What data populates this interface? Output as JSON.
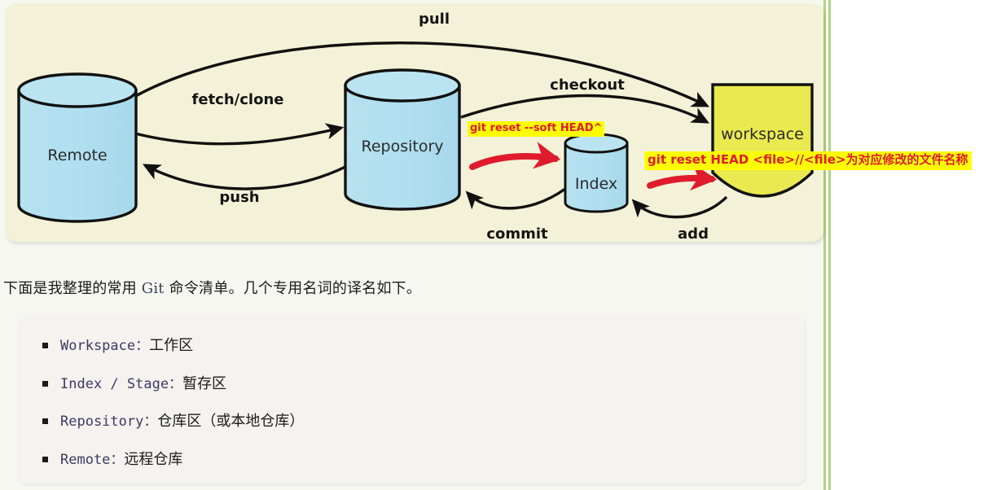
{
  "page": {
    "background_color": "#f7f7f2",
    "gutter_color": "#aed581"
  },
  "diagram": {
    "panel_color": "#f3f2d8",
    "cylinder_color": "#ade0ee",
    "workspace_color": "#eae94f",
    "arrow_color": "#111111",
    "annotation_highlight": "#ffff00",
    "annotation_text_color": "#e01b2e",
    "nodes": [
      {
        "id": "remote",
        "label": "Remote",
        "shape": "cylinder"
      },
      {
        "id": "repository",
        "label": "Repository",
        "shape": "cylinder"
      },
      {
        "id": "index",
        "label": "Index",
        "shape": "cylinder"
      },
      {
        "id": "workspace",
        "label": "workspace",
        "shape": "rounded-box"
      }
    ],
    "edges": [
      {
        "id": "pull",
        "label": "pull",
        "from": "remote",
        "to": "workspace"
      },
      {
        "id": "fetch-clone",
        "label": "fetch/clone",
        "from": "remote",
        "to": "repository"
      },
      {
        "id": "push",
        "label": "push",
        "from": "repository",
        "to": "remote"
      },
      {
        "id": "checkout",
        "label": "checkout",
        "from": "repository",
        "to": "workspace"
      },
      {
        "id": "commit",
        "label": "commit",
        "from": "index",
        "to": "repository"
      },
      {
        "id": "add",
        "label": "add",
        "from": "workspace",
        "to": "index"
      }
    ],
    "annotations": [
      {
        "id": "annot-soft-head",
        "text": "git reset --soft HEAD^"
      },
      {
        "id": "annot-reset-head",
        "text": "git reset HEAD <file>//<file>为对应修改的文件名称"
      }
    ]
  },
  "intro": {
    "before": "下面是我整理的常用 ",
    "term": "Git",
    "after": " 命令清单。几个专用名词的译名如下。"
  },
  "glossary": {
    "items": [
      {
        "term": "Workspace：",
        "gloss": "工作区"
      },
      {
        "term": "Index / Stage：",
        "gloss": "暂存区"
      },
      {
        "term": "Repository：",
        "gloss": "仓库区（或本地仓库）"
      },
      {
        "term": "Remote：",
        "gloss": "远程仓库"
      }
    ]
  }
}
